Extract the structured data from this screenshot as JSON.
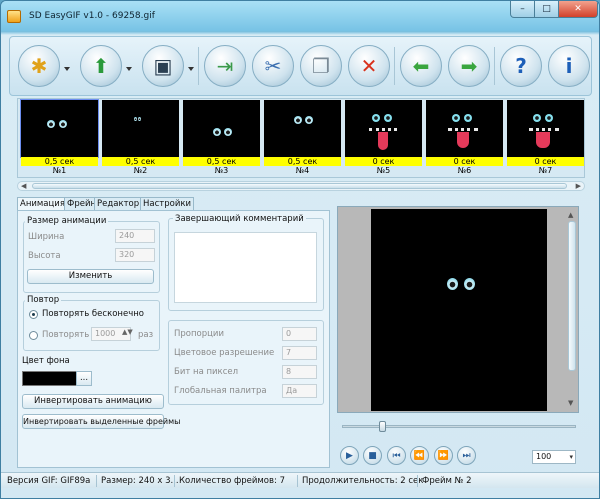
{
  "window": {
    "title": "SD EasyGIF v1.0 - 69258.gif",
    "min": "–",
    "max": "□",
    "close": "✕"
  },
  "toolbar": {
    "icons": [
      "new-icon",
      "open-icon",
      "save-icon",
      "import-icon",
      "cut-icon",
      "copy-icon",
      "delete-icon",
      "back-arrow-icon",
      "forward-arrow-icon",
      "help-icon",
      "info-icon"
    ]
  },
  "frames": [
    {
      "delay": "0,5 сек",
      "num": "№1"
    },
    {
      "delay": "0,5 сек",
      "num": "№2"
    },
    {
      "delay": "0,5 сек",
      "num": "№3"
    },
    {
      "delay": "0,5 сек",
      "num": "№4"
    },
    {
      "delay": "0 сек",
      "num": "№5"
    },
    {
      "delay": "0 сек",
      "num": "№6"
    },
    {
      "delay": "0 сек",
      "num": "№7"
    }
  ],
  "tabs": [
    "Анимация",
    "Фрейн",
    "Редактор",
    "Настройки"
  ],
  "animation": {
    "size_group": "Размер анимации",
    "width_label": "Ширина",
    "width_value": "240",
    "height_label": "Высота",
    "height_value": "320",
    "change_button": "Изменить",
    "repeat_group": "Повтор",
    "repeat_forever": "Повторять бесконечно",
    "repeat_n": "Повторять",
    "repeat_count": "1000",
    "repeat_unit": "раз",
    "bg_label": "Цвет фона",
    "bg_color": "#000000",
    "bg_more": "...",
    "invert_anim": "Инвертировать анимацию",
    "invert_selected": "Инвертировать выделенные фреймы",
    "comment_group": "Завершающий комментарий",
    "proportions_label": "Пропорции",
    "proportions_value": "0",
    "color_res_label": "Цветовое разрешение",
    "color_res_value": "7",
    "bits_label": "Бит на пиксел",
    "bits_value": "8",
    "global_palette_label": "Глобальная палитра",
    "global_palette_value": "Да"
  },
  "player": {
    "zoom": "100",
    "zoom_caret": "▾",
    "buttons": [
      "▶",
      "■",
      "⏮",
      "⏪",
      "⏩",
      "⏭"
    ]
  },
  "status": {
    "version": "Версия GIF: GIF89a",
    "size": "Размер: 240 x 3...",
    "count": "Количество фреймов: 7",
    "duration": "Продолжительность: 2 сек",
    "frame": "Фрейм № 2"
  },
  "colors": {
    "delay_bar": "#ffff00",
    "accent": "#6db9dc"
  }
}
